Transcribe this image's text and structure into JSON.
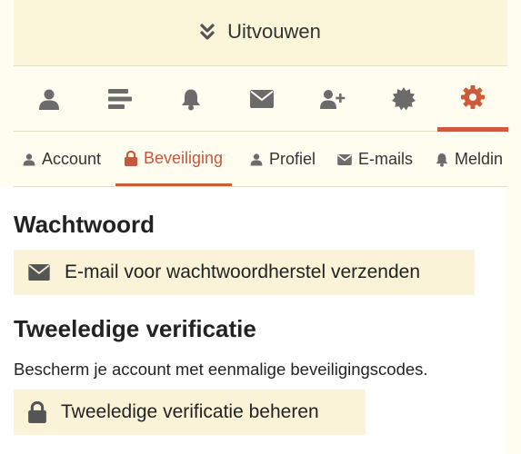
{
  "expand": {
    "label": "Uitvouwen"
  },
  "icon_nav": [
    {
      "icon": "user-icon"
    },
    {
      "icon": "list-icon"
    },
    {
      "icon": "bell-icon"
    },
    {
      "icon": "envelope-icon"
    },
    {
      "icon": "user-plus-icon"
    },
    {
      "icon": "badge-icon"
    },
    {
      "icon": "gear-icon",
      "active": true
    }
  ],
  "tabs": [
    {
      "label": "Account",
      "icon": "user-icon"
    },
    {
      "label": "Beveiliging",
      "icon": "lock-icon",
      "active": true
    },
    {
      "label": "Profiel",
      "icon": "user-icon"
    },
    {
      "label": "E-mails",
      "icon": "envelope-icon"
    },
    {
      "label": "Meldin",
      "icon": "bell-icon"
    }
  ],
  "password": {
    "heading": "Wachtwoord",
    "reset_button": "E-mail voor wachtwoordherstel verzenden"
  },
  "twofa": {
    "heading": "Tweeledige verificatie",
    "description": "Bescherm je account met eenmalige beveiligingscodes.",
    "manage_button": "Tweeledige verificatie beheren"
  },
  "colors": {
    "accent": "#cf5a3a",
    "icon": "#6b6b6b",
    "bar_bg": "#fbf5d9",
    "button_bg": "#faf3d7"
  }
}
